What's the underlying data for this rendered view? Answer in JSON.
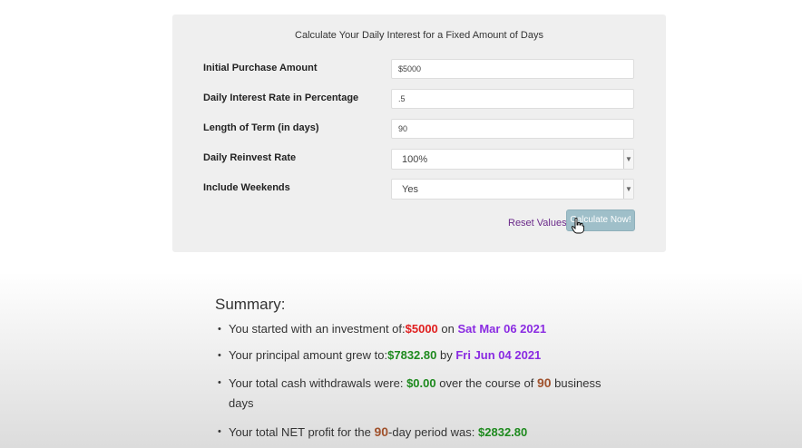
{
  "form": {
    "title": "Calculate Your Daily Interest for a Fixed Amount of Days",
    "fields": [
      {
        "label": "Initial Purchase Amount",
        "value": "$5000"
      },
      {
        "label": "Daily Interest Rate in Percentage",
        "value": ".5"
      },
      {
        "label": "Length of Term (in days)",
        "value": "90"
      }
    ],
    "selects": [
      {
        "label": "Daily Reinvest Rate",
        "value": "100%"
      },
      {
        "label": "Include Weekends",
        "value": "Yes"
      }
    ],
    "reset_label": "Reset Values",
    "calculate_label": "Calculate Now!"
  },
  "summary": {
    "title": "Summary:",
    "line1": {
      "prefix": "You started with an investment of:",
      "amount": "$5000",
      "mid": "on",
      "date": "Sat Mar 06 2021"
    },
    "line2": {
      "prefix": "Your principal amount grew to:",
      "amount": "$7832.80",
      "mid": "by",
      "date": "Fri Jun 04 2021"
    },
    "line3": {
      "prefix": "Your total cash withdrawals were:",
      "amount": "$0.00",
      "mid": "over the course of",
      "days": "90",
      "suffix": "business days"
    },
    "line4": {
      "prefix": "Your total NET profit for the",
      "days": "90",
      "mid": "-day period was:",
      "amount": "$2832.80"
    }
  },
  "colors": {
    "amount_start": "#e02020",
    "date": "#8a2be2",
    "amount": "#1e8a1e",
    "days": "#a0522d",
    "button": "#9fbfc9"
  }
}
